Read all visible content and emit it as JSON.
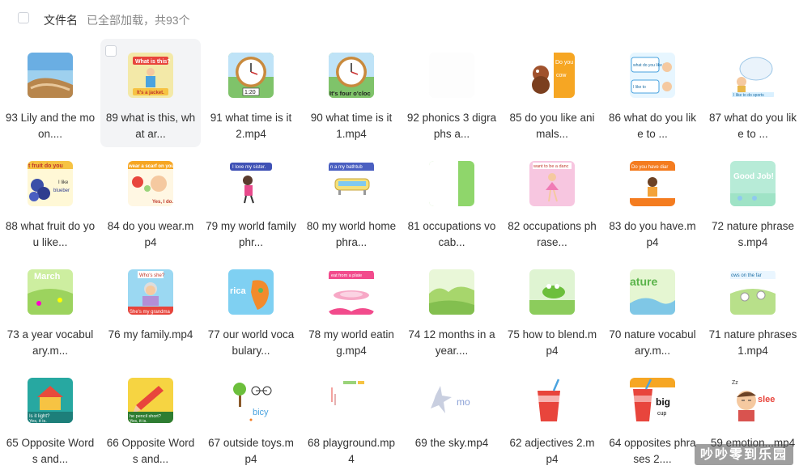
{
  "header": {
    "select_all_checked": false,
    "title": "文件名",
    "status": "已全部加载，共93个"
  },
  "files": [
    {
      "name": "93 Lily and the moon....",
      "thumb": "beach-scene-thumbnail"
    },
    {
      "name": "89 what is this, what ar...",
      "thumb": "what-is-this-thumbnail",
      "hover": true,
      "thumb_text": [
        "What is this?",
        "It's a jacket."
      ]
    },
    {
      "name": "91 what time is it 2.mp4",
      "thumb": "clock-thumbnail",
      "thumb_text": [
        "1:20"
      ]
    },
    {
      "name": "90 what time is it 1.mp4",
      "thumb": "clock-thumbnail",
      "thumb_text": [
        "It's four o'cloc"
      ]
    },
    {
      "name": "92 phonics 3 digraphs a...",
      "thumb": "blank-thumbnail"
    },
    {
      "name": "85 do you like animals...",
      "thumb": "animals-thumbnail",
      "thumb_text": [
        "Do you",
        "cow"
      ]
    },
    {
      "name": "86 what do you like to ...",
      "thumb": "kids-activity-thumbnail",
      "thumb_text": [
        "what do you like to",
        "I like to"
      ]
    },
    {
      "name": "87 what do you like to ...",
      "thumb": "kids-dream-thumbnail",
      "thumb_text": [
        "I like to do sports"
      ]
    },
    {
      "name": "88 what fruit do you like...",
      "thumb": "fruit-thumbnail",
      "thumb_text": [
        "t fruit do you",
        "I like",
        "blueber"
      ]
    },
    {
      "name": "84 do you wear.mp4",
      "thumb": "wear-thumbnail",
      "thumb_text": [
        "wear a scarf on you",
        "Yes, I do."
      ]
    },
    {
      "name": "79 my world family phr...",
      "thumb": "family-thumbnail",
      "thumb_text": [
        "I love my sister."
      ]
    },
    {
      "name": "80 my world home phra...",
      "thumb": "bathtub-thumbnail",
      "thumb_text": [
        "n a my bathtub"
      ]
    },
    {
      "name": "81 occupations vocab...",
      "thumb": "occupation-thumbnail"
    },
    {
      "name": "82 occupations phrase...",
      "thumb": "dancer-thumbnail",
      "thumb_text": [
        "want to be a danc"
      ]
    },
    {
      "name": "83 do you have.mp4",
      "thumb": "have-thumbnail",
      "thumb_text": [
        "Do you have diar"
      ]
    },
    {
      "name": "72 nature phrases.mp4",
      "thumb": "good-job-thumbnail",
      "thumb_text": [
        "Good Job!"
      ]
    },
    {
      "name": "73 a year vocabulary.m...",
      "thumb": "march-thumbnail",
      "thumb_text": [
        "March"
      ]
    },
    {
      "name": "76 my family.mp4",
      "thumb": "grandma-thumbnail",
      "thumb_text": [
        "Who's she?",
        "She's my grandma"
      ]
    },
    {
      "name": "77 our world vocabulary...",
      "thumb": "africa-thumbnail",
      "thumb_text": [
        "rica"
      ]
    },
    {
      "name": "78 my world eating.mp4",
      "thumb": "plate-thumbnail",
      "thumb_text": [
        "eat from a plate"
      ]
    },
    {
      "name": "74 12 months in a year....",
      "thumb": "landscape-thumbnail"
    },
    {
      "name": "75 how to blend.mp4",
      "thumb": "frog-thumbnail"
    },
    {
      "name": "70 nature vocabulary.m...",
      "thumb": "nature-river-thumbnail",
      "thumb_text": [
        "ature"
      ]
    },
    {
      "name": "71 nature phrases 1.mp4",
      "thumb": "farm-thumbnail",
      "thumb_text": [
        "ows on the far"
      ]
    },
    {
      "name": "65 Opposite Words and...",
      "thumb": "house-thumbnail",
      "thumb_text": [
        "Is it light?",
        "Yes, it is."
      ]
    },
    {
      "name": "66 Opposite Words and...",
      "thumb": "pencil-thumbnail",
      "thumb_text": [
        "he pencil short?",
        "Yes, it is."
      ]
    },
    {
      "name": "67 outside toys.mp4",
      "thumb": "bicycle-thumbnail",
      "thumb_text": [
        "bicy"
      ]
    },
    {
      "name": "68 playground.mp4",
      "thumb": "playground-thumbnail"
    },
    {
      "name": "69 the sky.mp4",
      "thumb": "sky-thumbnail",
      "thumb_text": [
        "mo"
      ]
    },
    {
      "name": "62 adjectives 2.mp4",
      "thumb": "cup-thumbnail"
    },
    {
      "name": "64 opposites phrases 2....",
      "thumb": "big-cup-thumbnail",
      "thumb_text": [
        "big",
        "cup"
      ]
    },
    {
      "name": "59 emotion...mp4",
      "thumb": "sleep-thumbnail",
      "thumb_text": [
        "Zz",
        "slee"
      ]
    }
  ],
  "watermark": "吵吵零到乐园"
}
